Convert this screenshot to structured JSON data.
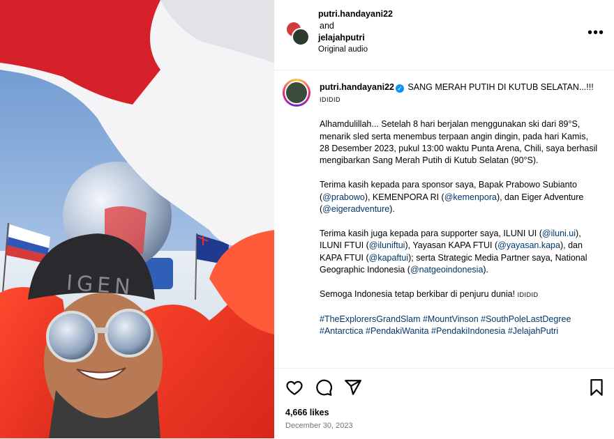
{
  "header": {
    "user1": "putri.handayani22",
    "and": "and",
    "user2": "jelajahputri",
    "audio": "Original audio",
    "more": "•••"
  },
  "caption": {
    "username": "putri.handayani22",
    "verified_icon": "✓",
    "title_line": " SANG MERAH PUTIH DI KUTUB SELATAN...!!! ",
    "title_emoji": "IDIDID",
    "p1": "Alhamdulillah... Setelah 8 hari berjalan menggunakan ski dari 89°S, menarik sled serta menembus terpaan angin dingin, pada hari Kamis, 28 Desember 2023, pukul 13:00 waktu Punta Arena, Chili, saya berhasil mengibarkan Sang Merah Putih di Kutub Selatan (90°S).",
    "p2_a": "Terima kasih kepada para sponsor saya, Bapak Prabowo Subianto (",
    "p2_l1": "@prabowo",
    "p2_b": "), KEMENPORA RI (",
    "p2_l2": "@kemenpora",
    "p2_c": "), dan Eiger Adventure (",
    "p2_l3": "@eigeradventure",
    "p2_d": ").",
    "p3_a": "Terima kasih juga kepada para supporter saya, ILUNI UI (",
    "p3_l1": "@iluni.ui",
    "p3_b": "), ILUNI FTUI (",
    "p3_l2": "@iluniftui",
    "p3_c": "), Yayasan KAPA FTUI (",
    "p3_l3": "@yayasan.kapa",
    "p3_d": "), dan KAPA FTUI (",
    "p3_l4": "@kapaftui",
    "p3_e": "); serta Strategic Media Partner saya, National Geographic Indonesia (",
    "p3_l5": "@natgeoindonesia",
    "p3_f": ").",
    "p4": "Semoga Indonesia tetap berkibar di penjuru dunia! ",
    "p4_emoji": "IDIDID",
    "tags": "#TheExplorersGrandSlam #MountVinson #SouthPoleLastDegree #Antarctica #PendakiWanita #PendakiIndonesia #JelajahPutri"
  },
  "footer": {
    "likes": "4,666 likes",
    "date": "December 30, 2023"
  },
  "icons": [
    "heart-icon",
    "comment-icon",
    "share-icon",
    "bookmark-icon",
    "more-icon",
    "verified-icon"
  ],
  "colors": {
    "link": "#00376b",
    "verified": "#0095f6",
    "muted": "#737373"
  }
}
